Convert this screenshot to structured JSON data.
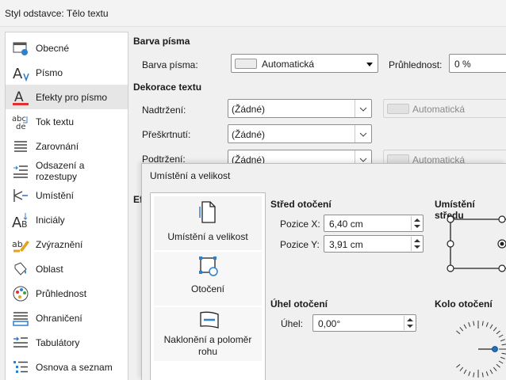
{
  "window": {
    "title": "Styl odstavce: Tělo textu"
  },
  "sidebar": {
    "items": [
      {
        "label": "Obecné",
        "icon": "general-settings-icon"
      },
      {
        "label": "Písmo",
        "icon": "font-icon"
      },
      {
        "label": "Efekty pro písmo",
        "icon": "font-effects-icon",
        "selected": true
      },
      {
        "label": "Tok textu",
        "icon": "text-flow-icon"
      },
      {
        "label": "Zarovnání",
        "icon": "alignment-icon"
      },
      {
        "label": "Odsazení a rozestupy",
        "icon": "indent-spacing-icon"
      },
      {
        "label": "Umístění",
        "icon": "position-icon"
      },
      {
        "label": "Iniciály",
        "icon": "drop-caps-icon"
      },
      {
        "label": "Zvýraznění",
        "icon": "highlight-icon"
      },
      {
        "label": "Oblast",
        "icon": "area-fill-icon"
      },
      {
        "label": "Průhlednost",
        "icon": "transparency-icon"
      },
      {
        "label": "Ohraničení",
        "icon": "borders-icon"
      },
      {
        "label": "Tabulátory",
        "icon": "tabs-icon"
      },
      {
        "label": "Osnova a seznam",
        "icon": "outline-list-icon"
      }
    ]
  },
  "font_color": {
    "section_title": "Barva písma",
    "label": "Barva písma:",
    "value": "Automatická",
    "transparency_label": "Průhlednost:",
    "transparency_value": "0 %"
  },
  "decoration": {
    "section_title": "Dekorace textu",
    "overline_label": "Nadtržení:",
    "overline_value": "(Žádné)",
    "overline_color": "Automatická",
    "strike_label": "Přeškrtnutí:",
    "strike_value": "(Žádné)",
    "underline_label": "Podtržení:",
    "underline_value": "(Žádné)",
    "underline_color": "Automatická"
  },
  "effects_partial": "Ef",
  "dialog": {
    "title": "Umístění a velikost",
    "list": [
      {
        "label": "Umístění a velikost",
        "icon": "page-position-icon"
      },
      {
        "label": "Otočení",
        "icon": "rotation-icon"
      },
      {
        "label": "Naklonění a poloměr rohu",
        "icon": "slant-icon"
      }
    ],
    "pivot_title": "Střed otočení",
    "pos_x_label": "Pozice X:",
    "pos_x_value": "6,40 cm",
    "pos_y_label": "Pozice Y:",
    "pos_y_value": "3,91 cm",
    "settings_title": "Umístění středu",
    "angle_title": "Úhel otočení",
    "angle_label": "Úhel:",
    "angle_value": "0,00°",
    "wheel_title": "Kolo otočení"
  },
  "colors": {
    "accent_red": "#e03030",
    "accent_blue": "#1f6fc5",
    "selection_gray": "#e6e6e6"
  }
}
